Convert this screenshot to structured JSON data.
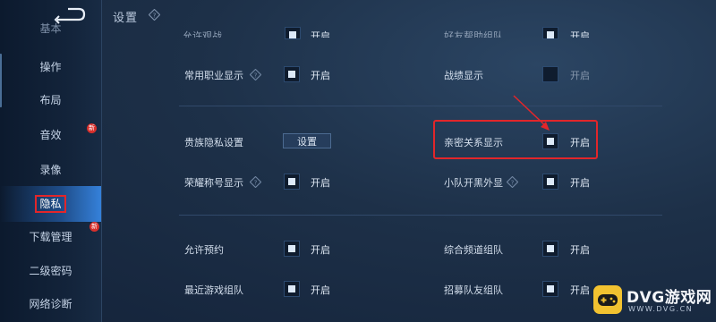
{
  "header": {
    "title": "设置"
  },
  "sidebar": {
    "items": [
      {
        "label": "操作"
      },
      {
        "label": "布局"
      },
      {
        "label": "音效"
      },
      {
        "label": "录像"
      },
      {
        "label": "隐私"
      },
      {
        "label": "下载管理"
      },
      {
        "label": "二级密码"
      },
      {
        "label": "网络诊断"
      }
    ],
    "new_badge": "新"
  },
  "rows": {
    "r0_left": {
      "label": "允许观战",
      "state": "开启",
      "checked": true
    },
    "r0_right": {
      "label": "好友帮助组队",
      "state": "开启",
      "checked": true
    },
    "r1_left": {
      "label": "常用职业显示",
      "state": "开启",
      "checked": true
    },
    "r1_right": {
      "label": "战绩显示",
      "state": "开启",
      "checked": false
    },
    "r2_left": {
      "label": "贵族隐私设置",
      "button": "设置"
    },
    "r2_right": {
      "label": "亲密关系显示",
      "state": "开启",
      "checked": true
    },
    "r3_left": {
      "label": "荣耀称号显示",
      "state": "开启",
      "checked": true
    },
    "r3_right": {
      "label": "小队开黑外显",
      "state": "开启",
      "checked": true
    },
    "r4_left": {
      "label": "允许预约",
      "state": "开启",
      "checked": true
    },
    "r4_right": {
      "label": "综合频道组队",
      "state": "开启",
      "checked": true
    },
    "r5_left": {
      "label": "最近游戏组队",
      "state": "开启",
      "checked": true
    },
    "r5_right": {
      "label": "招募队友组队",
      "state": "开启",
      "checked": true
    }
  },
  "watermark": {
    "text": "DVG游戏网",
    "sub": "WWW.DVG.CN"
  },
  "colors": {
    "highlight": "#e2262a",
    "accent": "#3c8cff",
    "badge": "#d8302c"
  }
}
